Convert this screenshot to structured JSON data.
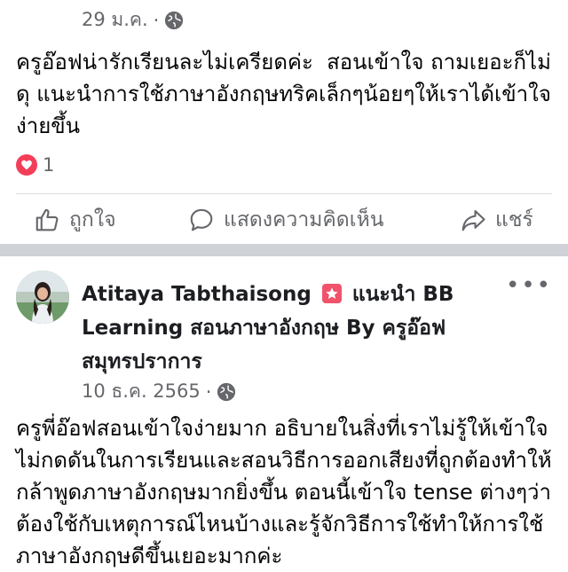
{
  "post1": {
    "timestamp": "29 ม.ค.",
    "separator": "·",
    "audience_icon": "globe-icon",
    "text": "ครูอ๊อฟน่ารักเรียนละไม่เครียดค่ะ  สอนเข้าใจ ถามเยอะก็ไม่ดุ แนะนำการใช้ภาษาอังกฤษทริคเล็กๆน้อยๆให้เราได้เข้าใจง่ายขึ้น",
    "reaction_count": "1",
    "reaction_icon": "heart-icon",
    "actions": {
      "like": "ถูกใจ",
      "comment": "แสดงความคิดเห็น",
      "share": "แชร์"
    }
  },
  "post2": {
    "author": "Atitaya Tabthaisong",
    "recommends_text": "แนะนำ BB Learning สอนภาษาอังกฤษ By ครูอ๊อฟ สมุทรปราการ",
    "timestamp": "10 ธ.ค. 2565",
    "separator": "·",
    "audience_icon": "globe-icon",
    "text": "ครูพี่อ๊อฟสอนเข้าใจง่ายมาก อธิบายในสิ่งที่เราไม่รู้ให้เข้าใจ ไม่กดดันในการเรียนและสอนวิธีการออกเสียงที่ถูกต้องทำให้กล้าพูดภาษาอังกฤษมากยิ่งขึ้น ตอนนี้เข้าใจ tense ต่างๆว่าต้องใช้กับเหตุการณ์ไหนบ้างและรู้จักวิธีการใช้ทำให้การใช้ภาษาอังกฤษดีขึ้นเยอะมากค่ะ",
    "more_label": "•••"
  },
  "colors": {
    "background": "#ffffff",
    "separator_band": "#cfd2d7",
    "secondary_text": "#65676b",
    "heart": "#f33e58",
    "recommend_badge": "#f0536b"
  }
}
